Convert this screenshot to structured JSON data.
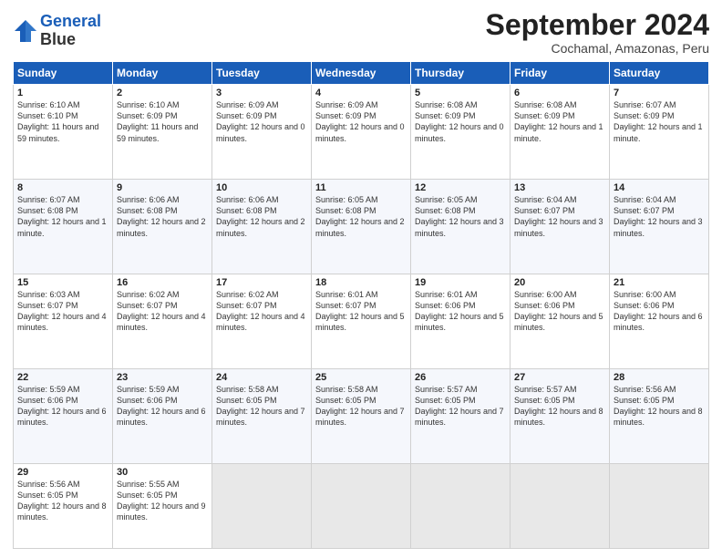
{
  "header": {
    "logo_line1": "General",
    "logo_line2": "Blue",
    "month_title": "September 2024",
    "location": "Cochamal, Amazonas, Peru"
  },
  "days_of_week": [
    "Sunday",
    "Monday",
    "Tuesday",
    "Wednesday",
    "Thursday",
    "Friday",
    "Saturday"
  ],
  "weeks": [
    [
      {
        "day": "1",
        "info": "Sunrise: 6:10 AM\nSunset: 6:10 PM\nDaylight: 11 hours\nand 59 minutes."
      },
      {
        "day": "2",
        "info": "Sunrise: 6:10 AM\nSunset: 6:09 PM\nDaylight: 11 hours\nand 59 minutes."
      },
      {
        "day": "3",
        "info": "Sunrise: 6:09 AM\nSunset: 6:09 PM\nDaylight: 12 hours\nand 0 minutes."
      },
      {
        "day": "4",
        "info": "Sunrise: 6:09 AM\nSunset: 6:09 PM\nDaylight: 12 hours\nand 0 minutes."
      },
      {
        "day": "5",
        "info": "Sunrise: 6:08 AM\nSunset: 6:09 PM\nDaylight: 12 hours\nand 0 minutes."
      },
      {
        "day": "6",
        "info": "Sunrise: 6:08 AM\nSunset: 6:09 PM\nDaylight: 12 hours\nand 1 minute."
      },
      {
        "day": "7",
        "info": "Sunrise: 6:07 AM\nSunset: 6:09 PM\nDaylight: 12 hours\nand 1 minute."
      }
    ],
    [
      {
        "day": "8",
        "info": "Sunrise: 6:07 AM\nSunset: 6:08 PM\nDaylight: 12 hours\nand 1 minute."
      },
      {
        "day": "9",
        "info": "Sunrise: 6:06 AM\nSunset: 6:08 PM\nDaylight: 12 hours\nand 2 minutes."
      },
      {
        "day": "10",
        "info": "Sunrise: 6:06 AM\nSunset: 6:08 PM\nDaylight: 12 hours\nand 2 minutes."
      },
      {
        "day": "11",
        "info": "Sunrise: 6:05 AM\nSunset: 6:08 PM\nDaylight: 12 hours\nand 2 minutes."
      },
      {
        "day": "12",
        "info": "Sunrise: 6:05 AM\nSunset: 6:08 PM\nDaylight: 12 hours\nand 3 minutes."
      },
      {
        "day": "13",
        "info": "Sunrise: 6:04 AM\nSunset: 6:07 PM\nDaylight: 12 hours\nand 3 minutes."
      },
      {
        "day": "14",
        "info": "Sunrise: 6:04 AM\nSunset: 6:07 PM\nDaylight: 12 hours\nand 3 minutes."
      }
    ],
    [
      {
        "day": "15",
        "info": "Sunrise: 6:03 AM\nSunset: 6:07 PM\nDaylight: 12 hours\nand 4 minutes."
      },
      {
        "day": "16",
        "info": "Sunrise: 6:02 AM\nSunset: 6:07 PM\nDaylight: 12 hours\nand 4 minutes."
      },
      {
        "day": "17",
        "info": "Sunrise: 6:02 AM\nSunset: 6:07 PM\nDaylight: 12 hours\nand 4 minutes."
      },
      {
        "day": "18",
        "info": "Sunrise: 6:01 AM\nSunset: 6:07 PM\nDaylight: 12 hours\nand 5 minutes."
      },
      {
        "day": "19",
        "info": "Sunrise: 6:01 AM\nSunset: 6:06 PM\nDaylight: 12 hours\nand 5 minutes."
      },
      {
        "day": "20",
        "info": "Sunrise: 6:00 AM\nSunset: 6:06 PM\nDaylight: 12 hours\nand 5 minutes."
      },
      {
        "day": "21",
        "info": "Sunrise: 6:00 AM\nSunset: 6:06 PM\nDaylight: 12 hours\nand 6 minutes."
      }
    ],
    [
      {
        "day": "22",
        "info": "Sunrise: 5:59 AM\nSunset: 6:06 PM\nDaylight: 12 hours\nand 6 minutes."
      },
      {
        "day": "23",
        "info": "Sunrise: 5:59 AM\nSunset: 6:06 PM\nDaylight: 12 hours\nand 6 minutes."
      },
      {
        "day": "24",
        "info": "Sunrise: 5:58 AM\nSunset: 6:05 PM\nDaylight: 12 hours\nand 7 minutes."
      },
      {
        "day": "25",
        "info": "Sunrise: 5:58 AM\nSunset: 6:05 PM\nDaylight: 12 hours\nand 7 minutes."
      },
      {
        "day": "26",
        "info": "Sunrise: 5:57 AM\nSunset: 6:05 PM\nDaylight: 12 hours\nand 7 minutes."
      },
      {
        "day": "27",
        "info": "Sunrise: 5:57 AM\nSunset: 6:05 PM\nDaylight: 12 hours\nand 8 minutes."
      },
      {
        "day": "28",
        "info": "Sunrise: 5:56 AM\nSunset: 6:05 PM\nDaylight: 12 hours\nand 8 minutes."
      }
    ],
    [
      {
        "day": "29",
        "info": "Sunrise: 5:56 AM\nSunset: 6:05 PM\nDaylight: 12 hours\nand 8 minutes."
      },
      {
        "day": "30",
        "info": "Sunrise: 5:55 AM\nSunset: 6:05 PM\nDaylight: 12 hours\nand 9 minutes."
      },
      {
        "day": "",
        "info": ""
      },
      {
        "day": "",
        "info": ""
      },
      {
        "day": "",
        "info": ""
      },
      {
        "day": "",
        "info": ""
      },
      {
        "day": "",
        "info": ""
      }
    ]
  ]
}
